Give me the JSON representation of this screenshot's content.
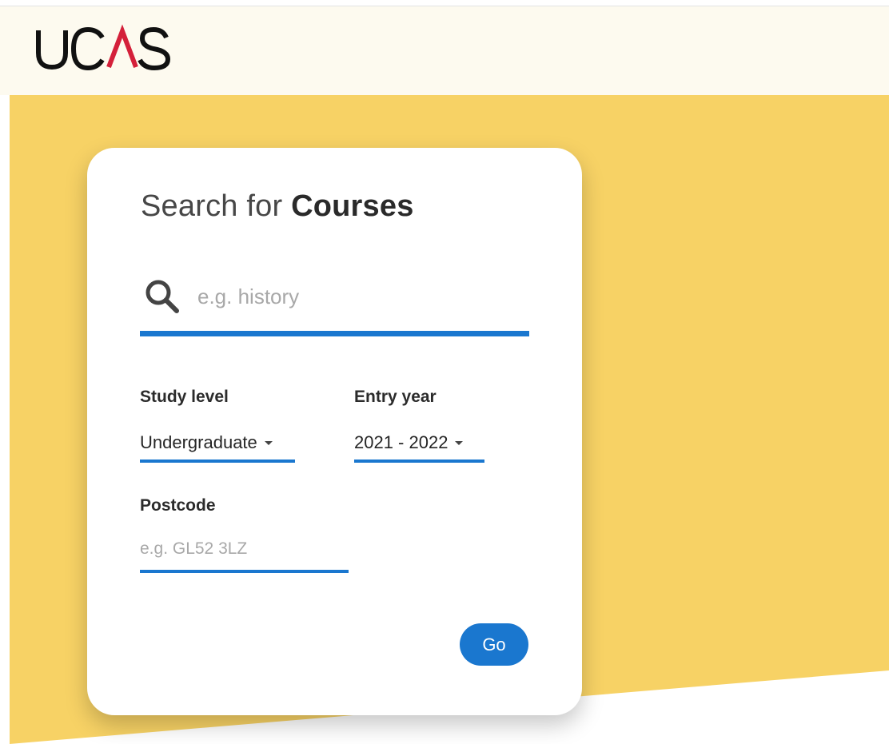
{
  "brand": {
    "logo_text": "UCAS",
    "accent_color": "#d4203a",
    "header_bg": "#fdfaef",
    "hero_color": "#f7d265"
  },
  "search_card": {
    "title_prefix": "Search for",
    "title_emphasis": "Courses",
    "search": {
      "icon": "search-icon",
      "placeholder": "e.g. history",
      "value": ""
    },
    "study_level": {
      "label": "Study level",
      "selected": "Undergraduate"
    },
    "entry_year": {
      "label": "Entry year",
      "selected": "2021 - 2022"
    },
    "postcode": {
      "label": "Postcode",
      "placeholder": "e.g. GL52 3LZ",
      "value": ""
    },
    "go_button": {
      "label": "Go",
      "color": "#1a77cf"
    }
  }
}
